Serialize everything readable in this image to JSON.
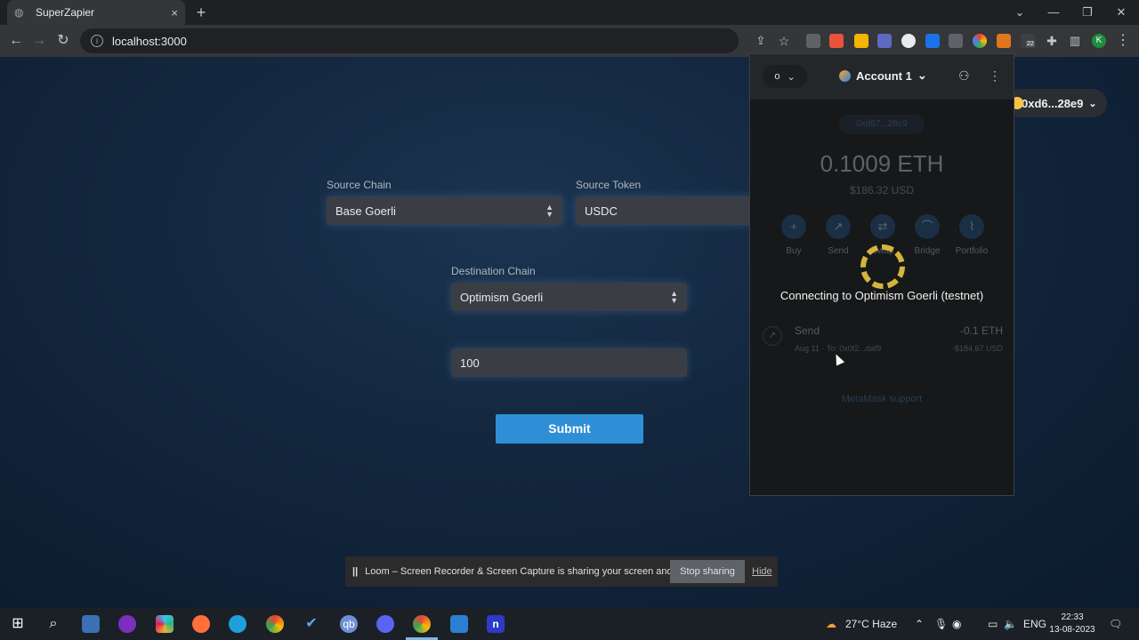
{
  "browser": {
    "tab_title": "SuperZapier",
    "tab_close": "×",
    "new_tab": "+",
    "url": "localhost:3000",
    "profile_initial": "K",
    "extension_badge": "22"
  },
  "form": {
    "source_chain_label": "Source Chain",
    "source_chain_value": "Base Goerli",
    "source_token_label": "Source Token",
    "source_token_value": "USDC",
    "destination_chain_label": "Destination Chain",
    "destination_chain_value": "Optimism Goerli",
    "amount_value": "100",
    "submit_label": "Submit"
  },
  "account_pill": "0xd6...28e9",
  "metamask": {
    "network_short": "o",
    "account_name": "Account 1",
    "address": "0xd67...28e9",
    "balance": "0.1009 ETH",
    "balance_usd": "$186.32 USD",
    "actions": [
      "Buy",
      "Send",
      "Swap",
      "Bridge",
      "Portfolio"
    ],
    "status": "Connecting to Optimism Goerli (testnet)",
    "tx_title": "Send",
    "tx_amount": "-0.1 ETH",
    "tx_sub": "Aug 11 · To: 0x0f2...daf9",
    "tx_usd": "-$184.67 USD",
    "support": "MetaMask support"
  },
  "loom": {
    "message": "Loom – Screen Recorder & Screen Capture is sharing your screen and audio.",
    "stop_label": "Stop sharing",
    "hide_label": "Hide"
  },
  "taskbar": {
    "weather": "27°C  Haze",
    "lang": "ENG",
    "time": "22:33",
    "date": "13-08-2023"
  },
  "colors": {
    "submit": "#2e8fd6",
    "page_bg": "#12263d",
    "spinner": "#d4b43c"
  }
}
